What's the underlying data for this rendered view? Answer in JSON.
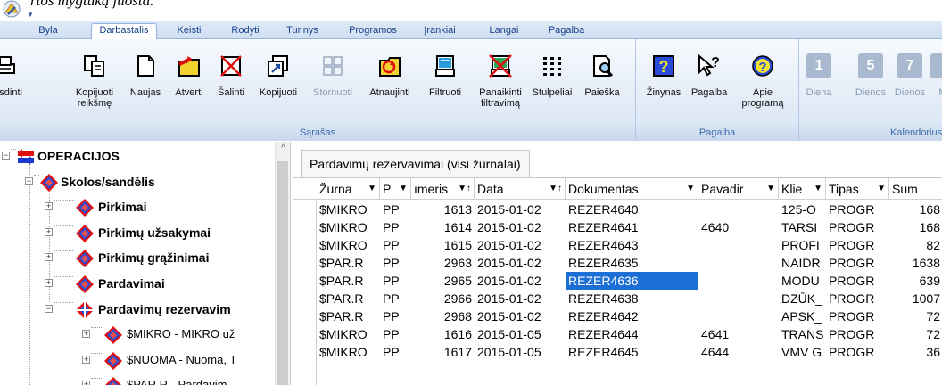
{
  "doc": {
    "text": "rtos mygtuką juosta."
  },
  "menu": {
    "tabs": [
      {
        "label": "Byla",
        "active": false
      },
      {
        "label": "Darbastalis",
        "active": true
      },
      {
        "label": "Keisti",
        "active": false
      },
      {
        "label": "Rodyti",
        "active": false
      },
      {
        "label": "Turinys",
        "active": false
      },
      {
        "label": "Programos",
        "active": false
      },
      {
        "label": "Įrankiai",
        "active": false
      },
      {
        "label": "Langai",
        "active": false
      },
      {
        "label": "Pagalba",
        "active": false
      }
    ]
  },
  "ribbon": {
    "groups": [
      {
        "label": "Sąrašas"
      },
      {
        "label": "Pagalba"
      },
      {
        "label": "Kalendorius"
      }
    ],
    "buttons": [
      {
        "label": "ausdinti",
        "icon": "print-icon"
      },
      {
        "label": "Kopijuoti\nreikšmę",
        "icon": "copy-value-icon"
      },
      {
        "label": "Naujas",
        "icon": "new-doc-icon"
      },
      {
        "label": "Atverti",
        "icon": "open-folder-icon"
      },
      {
        "label": "Šalinti",
        "icon": "delete-icon"
      },
      {
        "label": "Kopijuoti",
        "icon": "copy-icon"
      },
      {
        "label": "Stornuoti",
        "icon": "storno-icon",
        "disabled": true
      },
      {
        "label": "Atnaujinti",
        "icon": "refresh-icon"
      },
      {
        "label": "Filtruoti",
        "icon": "filter-icon"
      },
      {
        "label": "Panaikinti\nfiltravimą",
        "icon": "clear-filter-icon"
      },
      {
        "label": "Stulpeliai",
        "icon": "columns-icon"
      },
      {
        "label": "Paieška",
        "icon": "search-icon"
      },
      {
        "label": "Žinynas",
        "icon": "help-book-icon"
      },
      {
        "label": "Pagalba",
        "icon": "help-pointer-icon"
      },
      {
        "label": "Apie\nprogramą",
        "icon": "about-icon"
      },
      {
        "label": "Diena",
        "icon": "day-icon",
        "disabled": true,
        "num": "1"
      },
      {
        "label": "Dienos",
        "icon": "days-icon",
        "disabled": true,
        "num": "5"
      },
      {
        "label": "Dienos",
        "icon": "week-icon",
        "disabled": true,
        "num": "7"
      },
      {
        "label": "M",
        "icon": "month-icon",
        "disabled": true
      }
    ]
  },
  "tree": {
    "nodes": [
      {
        "label": "OPERACIJOS",
        "expander": "−"
      },
      {
        "label": "Skolos/sandėlis",
        "expander": "−"
      },
      {
        "label": "Pirkimai",
        "expander": "+"
      },
      {
        "label": "Pirkimų užsakymai",
        "expander": "+"
      },
      {
        "label": "Pirkimų grąžinimai",
        "expander": "+"
      },
      {
        "label": "Pardavimai",
        "expander": "+"
      },
      {
        "label": "Pardavimų rezervavim",
        "expander": "−"
      },
      {
        "label": "$MIKRO - MIKRO  už",
        "expander": "+"
      },
      {
        "label": "$NUOMA - Nuoma, T",
        "expander": "+"
      },
      {
        "label": "$PAR.R - Pardavim",
        "expander": "+"
      }
    ]
  },
  "grid": {
    "title": "Pardavimų rezervavimai (visi žurnalai)",
    "columns": [
      {
        "label": "Žurna",
        "arrow": "▼"
      },
      {
        "label": "P",
        "arrow": "▼"
      },
      {
        "label": "ımeris",
        "arrow": "▼↑"
      },
      {
        "label": "Data",
        "arrow": "▼↑"
      },
      {
        "label": "Dokumentas",
        "arrow": "▼"
      },
      {
        "label": "Pavadir",
        "arrow": "▼"
      },
      {
        "label": "Klie",
        "arrow": "▼"
      },
      {
        "label": "Tipas",
        "arrow": "▼"
      },
      {
        "label": "Sum",
        "arrow": ""
      }
    ],
    "rows": [
      [
        "$MIKRO",
        "PP",
        "1613",
        "2015-01-02",
        "REZER4640",
        "",
        "125-O",
        "PROGR",
        "168"
      ],
      [
        "$MIKRO",
        "PP",
        "1614",
        "2015-01-02",
        "REZER4641",
        "4640",
        "TARSI",
        "PROGR",
        "168"
      ],
      [
        "$MIKRO",
        "PP",
        "1615",
        "2015-01-02",
        "REZER4643",
        "",
        "PROFI",
        "PROGR",
        "82"
      ],
      [
        "$PAR.R",
        "PP",
        "2963",
        "2015-01-02",
        "REZER4635",
        "",
        "NAIDR",
        "PROGR",
        "1638"
      ],
      [
        "$PAR.R",
        "PP",
        "2965",
        "2015-01-02",
        "REZER4636",
        "",
        "MODU",
        "PROGR",
        "639"
      ],
      [
        "$PAR.R",
        "PP",
        "2966",
        "2015-01-02",
        "REZER4638",
        "",
        "DZŪK_",
        "PROGR",
        "1007"
      ],
      [
        "$PAR.R",
        "PP",
        "2968",
        "2015-01-02",
        "REZER4642",
        "",
        "APSK_",
        "PROGR",
        "72"
      ],
      [
        "$MIKRO",
        "PP",
        "1616",
        "2015-01-05",
        "REZER4644",
        "4641",
        "TRANS",
        "PROGR",
        "72"
      ],
      [
        "$MIKRO",
        "PP",
        "1617",
        "2015-01-05",
        "REZER4645",
        "4644",
        "VMV G",
        "PROGR",
        "36"
      ]
    ],
    "selected": {
      "row": 4,
      "col": 4
    }
  }
}
